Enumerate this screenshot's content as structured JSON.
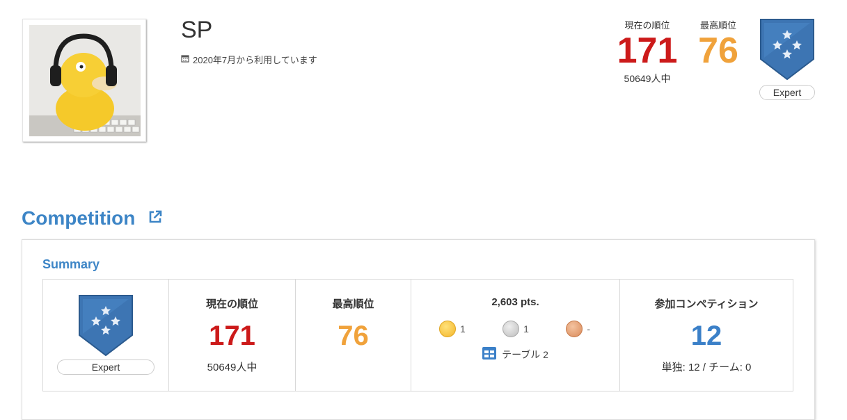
{
  "profile": {
    "username": "SP",
    "since": "2020年7月から利用しています"
  },
  "header_rank": {
    "current_label": "現在の順位",
    "current_value": "171",
    "total": "50649人中",
    "best_label": "最高順位",
    "best_value": "76",
    "tier": "Expert"
  },
  "competition": {
    "title": "Competition"
  },
  "summary": {
    "title": "Summary",
    "tier": "Expert",
    "current_label": "現在の順位",
    "current_value": "171",
    "total": "50649人中",
    "best_label": "最高順位",
    "best_value": "76",
    "points": "2,603 pts.",
    "gold": "1",
    "silver": "1",
    "bronze": "-",
    "table_link": "テーブル 2",
    "participated_label": "参加コンペティション",
    "participated_value": "12",
    "breakdown": "単独: 12 / チーム: 0"
  },
  "colors": {
    "red": "#cc1a1a",
    "orange": "#f0a23b",
    "blue": "#3b80c8"
  }
}
